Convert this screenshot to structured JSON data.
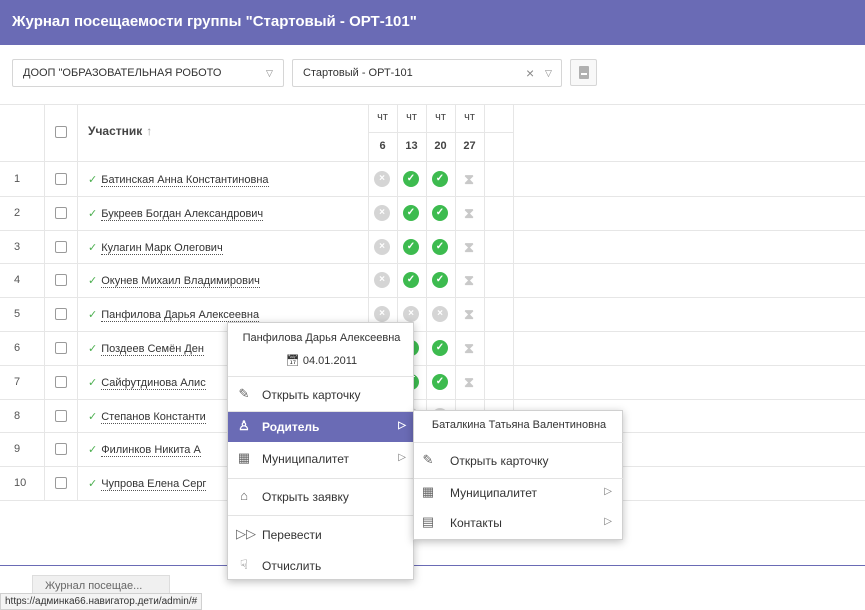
{
  "header": {
    "title": "Журнал посещаемости группы \"Стартовый - ОРТ-101\""
  },
  "filters": {
    "program": "ДООП \"ОБРАЗОВАТЕЛЬНАЯ РОБОТО",
    "group": "Стартовый - ОРТ-101"
  },
  "table": {
    "participant_header": "Участник",
    "sort_icon": "↑",
    "days": [
      {
        "weekday": "чт",
        "date": "6"
      },
      {
        "weekday": "чт",
        "date": "13"
      },
      {
        "weekday": "чт",
        "date": "20"
      },
      {
        "weekday": "чт",
        "date": "27"
      }
    ],
    "rows": [
      {
        "num": "1",
        "name": "Батинская Анна Константиновна",
        "marks": [
          "absent",
          "present",
          "present",
          "pending"
        ]
      },
      {
        "num": "2",
        "name": "Букреев Богдан Александрович",
        "marks": [
          "absent",
          "present",
          "present",
          "pending"
        ]
      },
      {
        "num": "3",
        "name": "Кулагин Марк Олегович",
        "marks": [
          "absent",
          "present",
          "present",
          "pending"
        ]
      },
      {
        "num": "4",
        "name": "Окунев Михаил Владимирович",
        "marks": [
          "absent",
          "present",
          "present",
          "pending"
        ]
      },
      {
        "num": "5",
        "name": "Панфилова Дарья Алексеевна",
        "marks": [
          "absent",
          "absent",
          "absent",
          "pending"
        ]
      },
      {
        "num": "6",
        "name": "Поздеев Семён Ден",
        "marks": [
          "absent",
          "present",
          "present",
          "pending"
        ]
      },
      {
        "num": "7",
        "name": "Сайфутдинова Алис",
        "marks": [
          "absent",
          "present",
          "present",
          "pending"
        ]
      },
      {
        "num": "8",
        "name": "Степанов Константи",
        "marks": [
          "absent",
          "absent",
          "absent",
          "pending"
        ]
      },
      {
        "num": "9",
        "name": "Филинков Никита А",
        "marks": [
          "absent",
          "present",
          "present",
          "pending"
        ]
      },
      {
        "num": "10",
        "name": "Чупрова Елена Серг",
        "marks": [
          "absent",
          "present",
          "present",
          "pending"
        ]
      }
    ]
  },
  "context_menu": {
    "person_name": "Панфилова Дарья Алексеевна",
    "birth_date": "04.01.2011",
    "items": [
      {
        "label": "Открыть карточку",
        "icon": "edit-icon"
      },
      {
        "label": "Родитель",
        "icon": "user-icon"
      },
      {
        "label": "Муниципалитет",
        "icon": "building-icon"
      },
      {
        "label": "Открыть заявку",
        "icon": "institution-icon"
      },
      {
        "label": "Перевести",
        "icon": "forward-icon"
      },
      {
        "label": "Отчислить",
        "icon": "thumbs-down-icon"
      }
    ]
  },
  "submenu": {
    "parent_name": "Баталкина Татьяна Валентиновна",
    "items": [
      {
        "label": "Открыть карточку",
        "icon": "edit-icon"
      },
      {
        "label": "Муниципалитет",
        "icon": "building-icon"
      },
      {
        "label": "Контакты",
        "icon": "contacts-icon"
      }
    ]
  },
  "footer": {
    "tab_label": "Журнал посещае..."
  },
  "status_url": "https://админка66.навигатор.дети/admin/#",
  "colors": {
    "accent": "#6a6bb5",
    "present": "#3dbb4f",
    "absent": "#d5d5d5"
  }
}
